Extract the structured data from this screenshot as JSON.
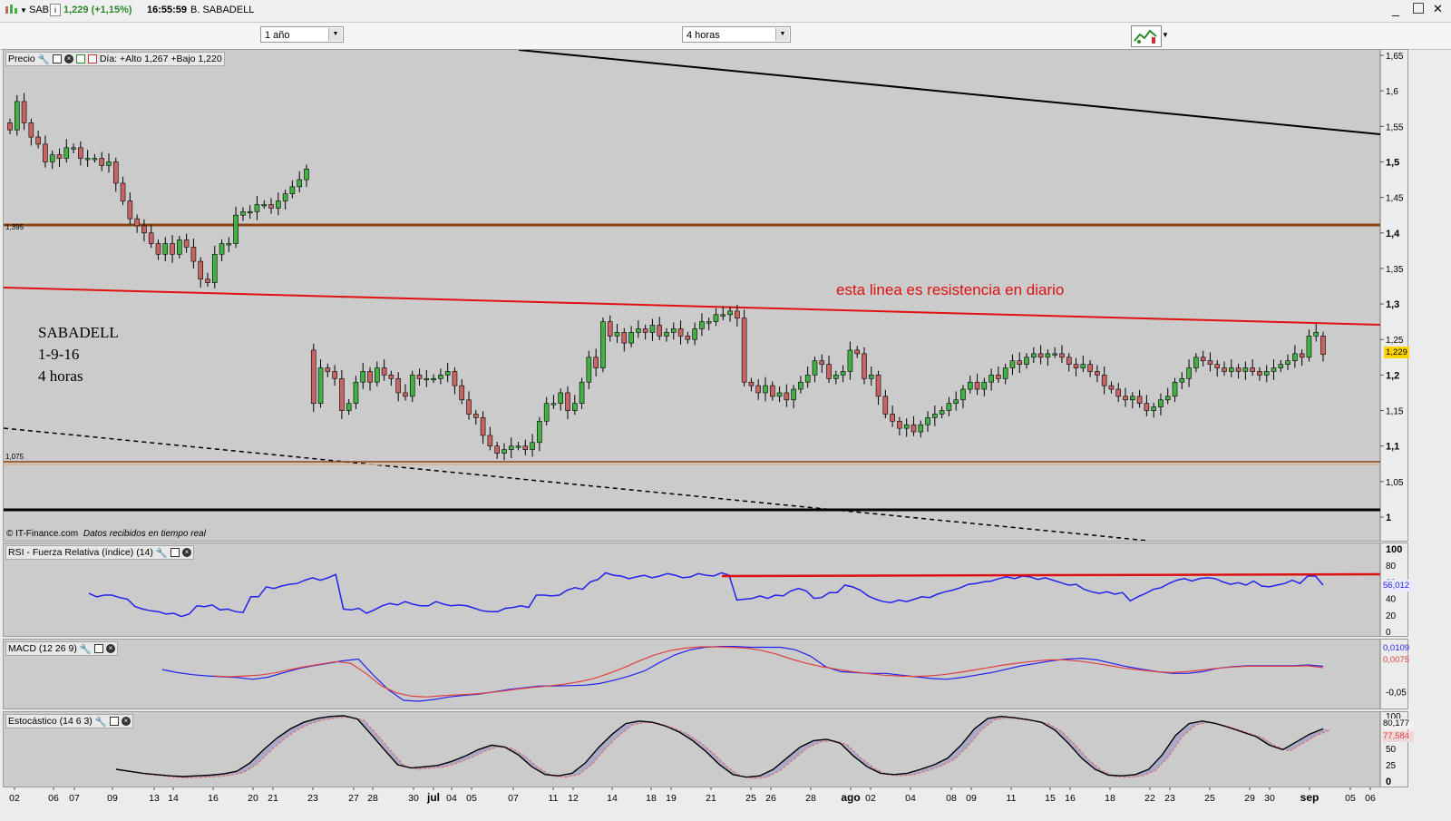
{
  "titlebar": {
    "symbol": "SAB",
    "info_icon": "i",
    "price": "1,229 (+1,15%)",
    "time": "16:55:59",
    "name": "B. SABADELL"
  },
  "controls": {
    "period": "1 año",
    "interval": "4 horas"
  },
  "colors": {
    "up_candle": "#43b043",
    "down_candle": "#c86464",
    "rsi_line": "#2222ee",
    "macd_line": "#2222ee",
    "signal_line": "#e04040",
    "resistance": "#e01010",
    "support": "#8b4513"
  },
  "price_panel": {
    "label": "Precio",
    "day_info": "Día: +Alto 1,267 +Bajo 1,220",
    "copyright": "© IT-Finance.com",
    "realtime": "Datos recibidos en tiempo real",
    "annotation": "esta linea es resistencia en diario",
    "note": [
      "SABADELL",
      "1-9-16",
      "4 horas"
    ],
    "level_1_395": "1,395",
    "level_1_075": "1,075",
    "last_price": "1,229"
  },
  "rsi_panel": {
    "label": "RSI - Fuerza Relativa (índice) (14)",
    "last": "56,012",
    "ticks": [
      "100",
      "80",
      "60",
      "40",
      "20",
      "0"
    ]
  },
  "macd_panel": {
    "label": "MACD (12 26 9)",
    "last_macd": "0,0109",
    "last_signal": "0,0075",
    "ticks": [
      "-0,05"
    ]
  },
  "stoch_panel": {
    "label": "Estocástico (14 6 3)",
    "last_k": "80,177",
    "last_d": "77,584",
    "ticks": [
      "100",
      "50",
      "25",
      "0"
    ]
  },
  "chart_data": [
    {
      "type": "candlestick",
      "ylim": [
        1.0,
        1.65
      ],
      "yticks": [
        "1,65",
        "1,6",
        "1,55",
        "1,5",
        "1,45",
        "1,4",
        "1,35",
        "1,3",
        "1,25",
        "1,2",
        "1,15",
        "1,1",
        "1,05",
        "1"
      ],
      "xticks": [
        "02",
        "06",
        "07",
        "09",
        "13",
        "14",
        "16",
        "20",
        "21",
        "23",
        "27",
        "28",
        "30",
        "jul",
        "04",
        "05",
        "07",
        "11",
        "12",
        "14",
        "18",
        "19",
        "21",
        "25",
        "26",
        "28",
        "ago",
        "02",
        "04",
        "08",
        "09",
        "11",
        "15",
        "16",
        "18",
        "22",
        "23",
        "25",
        "29",
        "30",
        "sep",
        "05",
        "06"
      ],
      "close": [
        1.545,
        1.585,
        1.555,
        1.535,
        1.525,
        1.5,
        1.51,
        1.505,
        1.52,
        1.52,
        1.505,
        1.505,
        1.505,
        1.495,
        1.5,
        1.47,
        1.445,
        1.42,
        1.41,
        1.4,
        1.385,
        1.37,
        1.385,
        1.37,
        1.39,
        1.38,
        1.36,
        1.335,
        1.33,
        1.37,
        1.385,
        1.385,
        1.425,
        1.43,
        1.43,
        1.44,
        1.44,
        1.435,
        1.445,
        1.455,
        1.465,
        1.475,
        1.49,
        1.16,
        1.21,
        1.205,
        1.195,
        1.15,
        1.16,
        1.19,
        1.205,
        1.19,
        1.21,
        1.2,
        1.195,
        1.175,
        1.17,
        1.2,
        1.195,
        1.195,
        1.195,
        1.2,
        1.205,
        1.185,
        1.165,
        1.145,
        1.14,
        1.115,
        1.1,
        1.09,
        1.095,
        1.1,
        1.1,
        1.095,
        1.105,
        1.135,
        1.16,
        1.16,
        1.175,
        1.15,
        1.16,
        1.19,
        1.225,
        1.21,
        1.275,
        1.255,
        1.26,
        1.245,
        1.26,
        1.265,
        1.26,
        1.27,
        1.255,
        1.26,
        1.265,
        1.255,
        1.25,
        1.265,
        1.275,
        1.275,
        1.285,
        1.285,
        1.29,
        1.28,
        1.19,
        1.185,
        1.175,
        1.185,
        1.17,
        1.175,
        1.165,
        1.18,
        1.19,
        1.2,
        1.22,
        1.215,
        1.195,
        1.2,
        1.205,
        1.235,
        1.23,
        1.195,
        1.2,
        1.17,
        1.145,
        1.135,
        1.125,
        1.13,
        1.12,
        1.13,
        1.14,
        1.145,
        1.15,
        1.16,
        1.165,
        1.18,
        1.19,
        1.18,
        1.19,
        1.2,
        1.195,
        1.21,
        1.22,
        1.215,
        1.225,
        1.23,
        1.225,
        1.23,
        1.23,
        1.225,
        1.215,
        1.21,
        1.215,
        1.205,
        1.2,
        1.185,
        1.18,
        1.17,
        1.165,
        1.17,
        1.16,
        1.15,
        1.155,
        1.165,
        1.17,
        1.19,
        1.195,
        1.21,
        1.225,
        1.22,
        1.215,
        1.21,
        1.205,
        1.21,
        1.205,
        1.21,
        1.205,
        1.2,
        1.205,
        1.21,
        1.215,
        1.22,
        1.23,
        1.225,
        1.255,
        1.26,
        1.229
      ]
    },
    {
      "type": "line",
      "title": "RSI - Fuerza Relativa (índice) (14)",
      "ylim": [
        0,
        100
      ],
      "values": [
        46,
        42,
        44,
        44,
        41,
        39,
        30,
        27,
        25,
        24,
        21,
        22,
        18,
        21,
        31,
        30,
        32,
        26,
        27,
        24,
        23,
        42,
        42,
        54,
        52,
        55,
        57,
        58,
        62,
        65,
        62,
        65,
        69,
        27,
        26,
        28,
        22,
        26,
        31,
        34,
        32,
        36,
        33,
        31,
        31,
        36,
        33,
        31,
        32,
        31,
        28,
        25,
        24,
        24,
        28,
        29,
        31,
        29,
        44,
        44,
        43,
        44,
        50,
        53,
        51,
        60,
        63,
        71,
        68,
        67,
        64,
        66,
        68,
        65,
        67,
        70,
        68,
        65,
        66,
        70,
        68,
        67,
        71,
        68,
        38,
        39,
        40,
        43,
        40,
        44,
        43,
        49,
        52,
        49,
        40,
        41,
        47,
        47,
        56,
        54,
        50,
        43,
        39,
        36,
        35,
        38,
        36,
        39,
        42,
        41,
        45,
        48,
        50,
        53,
        57,
        58,
        60,
        61,
        64,
        66,
        64,
        67,
        66,
        63,
        65,
        62,
        59,
        56,
        57,
        51,
        48,
        46,
        48,
        45,
        47,
        37,
        42,
        46,
        51,
        53,
        58,
        62,
        64,
        61,
        64,
        65,
        64,
        60,
        57,
        59,
        56,
        61,
        55,
        54,
        56,
        58,
        62,
        58,
        67,
        67,
        56
      ]
    },
    {
      "type": "line",
      "title": "MACD (12 26 9)",
      "series": [
        {
          "values": [
            0.003,
            -0.004,
            -0.009,
            -0.012,
            -0.014,
            -0.016,
            -0.02,
            -0.015,
            -0.005,
            0.005,
            0.012,
            0.018,
            0.024,
            0.028,
            -0.01,
            -0.045,
            -0.07,
            -0.072,
            -0.068,
            -0.062,
            -0.058,
            -0.055,
            -0.05,
            -0.044,
            -0.04,
            -0.036,
            -0.036,
            -0.035,
            -0.034,
            -0.03,
            -0.022,
            -0.012,
            0.0,
            0.02,
            0.038,
            0.05,
            0.056,
            0.058,
            0.058,
            0.056,
            0.056,
            0.056,
            0.05,
            0.035,
            0.01,
            -0.002,
            -0.004,
            -0.006,
            -0.006,
            -0.01,
            -0.014,
            -0.018,
            -0.02,
            -0.016,
            -0.01,
            -0.004,
            0.004,
            0.012,
            0.018,
            0.024,
            0.028,
            0.03,
            0.026,
            0.018,
            0.01,
            0.004,
            -0.002,
            -0.006,
            -0.006,
            -0.002,
            0.006,
            0.01,
            0.012,
            0.012,
            0.012,
            0.012,
            0.014,
            0.0109
          ]
        },
        {
          "values": [
            -0.012,
            -0.014,
            -0.012,
            -0.01,
            -0.005,
            0.003,
            0.01,
            0.016,
            0.022,
            0.018,
            -0.006,
            -0.035,
            -0.052,
            -0.06,
            -0.062,
            -0.059,
            -0.057,
            -0.055,
            -0.052,
            -0.048,
            -0.043,
            -0.039,
            -0.036,
            -0.032,
            -0.026,
            -0.018,
            -0.006,
            0.008,
            0.024,
            0.038,
            0.048,
            0.054,
            0.057,
            0.057,
            0.056,
            0.054,
            0.049,
            0.04,
            0.028,
            0.018,
            0.01,
            0.004,
            -0.002,
            -0.006,
            -0.01,
            -0.012,
            -0.013,
            -0.012,
            -0.009,
            -0.004,
            0.002,
            0.008,
            0.014,
            0.019,
            0.023,
            0.026,
            0.026,
            0.023,
            0.018,
            0.012,
            0.006,
            0.002,
            -0.002,
            -0.004,
            -0.002,
            0.002,
            0.006,
            0.009,
            0.011,
            0.011,
            0.011,
            0.011,
            0.012,
            0.0075
          ]
        }
      ]
    },
    {
      "type": "line",
      "title": "Estocástico (14 6 3)",
      "ylim": [
        0,
        100
      ],
      "series": [
        {
          "values": [
            18,
            15,
            12,
            10,
            8,
            7,
            8,
            9,
            11,
            15,
            28,
            48,
            66,
            80,
            90,
            96,
            99,
            100,
            95,
            72,
            48,
            25,
            20,
            22,
            24,
            30,
            38,
            48,
            55,
            52,
            40,
            22,
            10,
            8,
            12,
            28,
            52,
            72,
            88,
            92,
            90,
            84,
            75,
            62,
            45,
            25,
            10,
            6,
            8,
            18,
            35,
            52,
            62,
            64,
            58,
            38,
            22,
            12,
            10,
            12,
            18,
            25,
            35,
            55,
            80,
            96,
            99,
            97,
            94,
            90,
            78,
            58,
            35,
            18,
            9,
            8,
            10,
            18,
            40,
            70,
            88,
            92,
            88,
            82,
            75,
            68,
            55,
            48,
            60,
            72,
            80
          ]
        },
        {
          "values": [
            18,
            15,
            12,
            10,
            8,
            7,
            8,
            9,
            11,
            15,
            28,
            48,
            66,
            80,
            90,
            96,
            99,
            100,
            95,
            72,
            48,
            25,
            20,
            22,
            24,
            30,
            38,
            48,
            55,
            52,
            40,
            22,
            10,
            8,
            12,
            28,
            52,
            72,
            88,
            92,
            90,
            84,
            75,
            62,
            45,
            25,
            10,
            6,
            8,
            18,
            35,
            52,
            62,
            64,
            58,
            38,
            22,
            12,
            10,
            12,
            18,
            25,
            35,
            55,
            80,
            96,
            99,
            97,
            94,
            90,
            78,
            58,
            35,
            18,
            9,
            8,
            10,
            18,
            40,
            70,
            88,
            92,
            88,
            82,
            75,
            68,
            55,
            48,
            60,
            72,
            80
          ]
        }
      ]
    }
  ]
}
